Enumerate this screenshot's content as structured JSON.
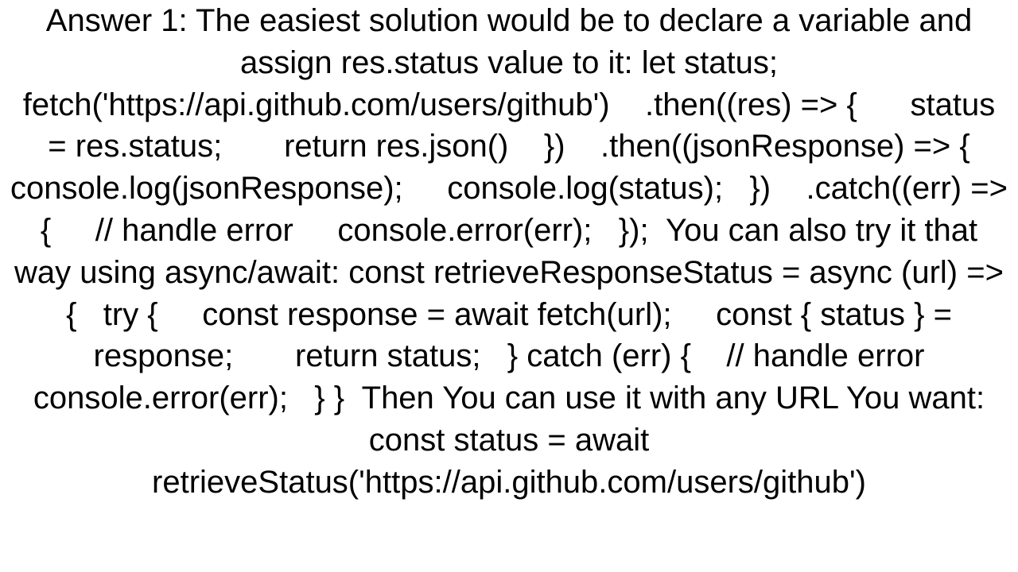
{
  "answer": {
    "text": "Answer 1: The easiest solution would be to declare a variable and assign res.status value to it: let status; fetch('https://api.github.com/users/github')    .then((res) => {      status = res.status;       return res.json()    })    .then((jsonResponse) => {      console.log(jsonResponse);     console.log(status);   })    .catch((err) => {     // handle error     console.error(err);   });  You can also try it that way using async/await: const retrieveResponseStatus = async (url) => {   try {     const response = await fetch(url);     const { status } = response;       return status;   } catch (err) {    // handle error     console.error(err);   } }  Then You can use it with any URL You want: const status = await retrieveStatus('https://api.github.com/users/github')"
  }
}
